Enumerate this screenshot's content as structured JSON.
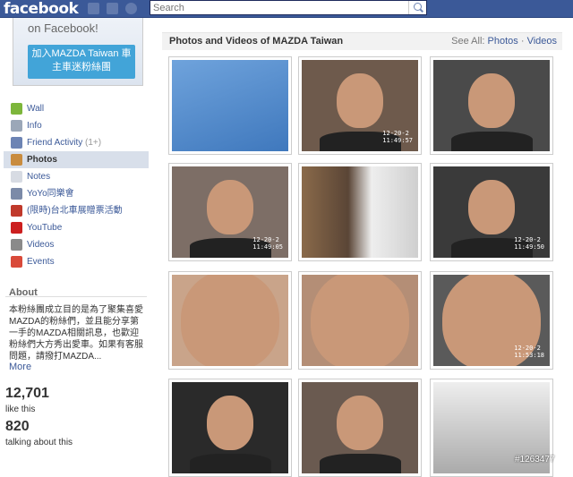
{
  "topbar": {
    "logo": "facebook",
    "search_placeholder": "Search"
  },
  "promo": {
    "text": "on Facebook!",
    "button": "加入MAZDA Taiwan 車主車迷粉絲團"
  },
  "nav": [
    {
      "label": "Wall",
      "icon": "wall-icon",
      "color": "#7db63b"
    },
    {
      "label": "Info",
      "icon": "info-icon",
      "color": "#9ba7b8"
    },
    {
      "label": "Friend Activity",
      "extra": "(1+)",
      "icon": "friends-icon",
      "color": "#6d84b4"
    },
    {
      "label": "Photos",
      "icon": "photos-icon",
      "color": "#c98c3f",
      "active": true
    },
    {
      "label": "Notes",
      "icon": "notes-icon",
      "color": "#d7dbe3"
    },
    {
      "label": "YoYo同樂會",
      "icon": "app-icon",
      "color": "#7b8aa8"
    },
    {
      "label": "(限時)台北車展贈票活動",
      "icon": "event-app-icon",
      "color": "#c0392b"
    },
    {
      "label": "YouTube",
      "icon": "youtube-icon",
      "color": "#cc1f1f"
    },
    {
      "label": "Videos",
      "icon": "video-icon",
      "color": "#8a8a8a"
    },
    {
      "label": "Events",
      "icon": "calendar-icon",
      "color": "#d94a3a"
    }
  ],
  "about": {
    "heading": "About",
    "text": "本粉絲團成立目的是為了聚集喜愛MAZDA的粉絲們，並且能分享第一手的MAZDA相關訊息，也歡迎粉絲們大方秀出愛車。如果有客服問題，請撥打MAZDA...",
    "more": "More"
  },
  "stats": {
    "likes": "12,701",
    "likes_label": "like this",
    "talking": "820",
    "talking_label": "talking about this"
  },
  "main": {
    "title": "Photos and Videos of MAZDA Taiwan",
    "see_all": "See All:",
    "photos_link": "Photos",
    "sep": "·",
    "videos_link": "Videos"
  },
  "thumbs": [
    {
      "bg": "#4f87c8",
      "stamp": ""
    },
    {
      "bg": "#6e5a4c",
      "stamp": "12-20-2\n11:49:57"
    },
    {
      "bg": "#4a4a4a",
      "stamp": ""
    },
    {
      "bg": "#7d6e66",
      "stamp": "12-20-2\n11:49:05"
    },
    {
      "bg": "#5e4a3c",
      "stamp": ""
    },
    {
      "bg": "#3a3a3a",
      "stamp": "12-20-2\n11:49:50"
    },
    {
      "bg": "#c9a48a",
      "stamp": ""
    },
    {
      "bg": "#b48e76",
      "stamp": ""
    },
    {
      "bg": "#5a5a5a",
      "stamp": "12-20-2\n11:53:18"
    },
    {
      "bg": "#2a2a2a",
      "stamp": ""
    },
    {
      "bg": "#6a5a50",
      "stamp": ""
    },
    {
      "bg": "#d0d0d0",
      "stamp": ""
    }
  ],
  "watermark": "#1263477",
  "colors": {
    "brand": "#3b5998",
    "link": "#3b5998",
    "active_nav": "#d8dfea"
  }
}
